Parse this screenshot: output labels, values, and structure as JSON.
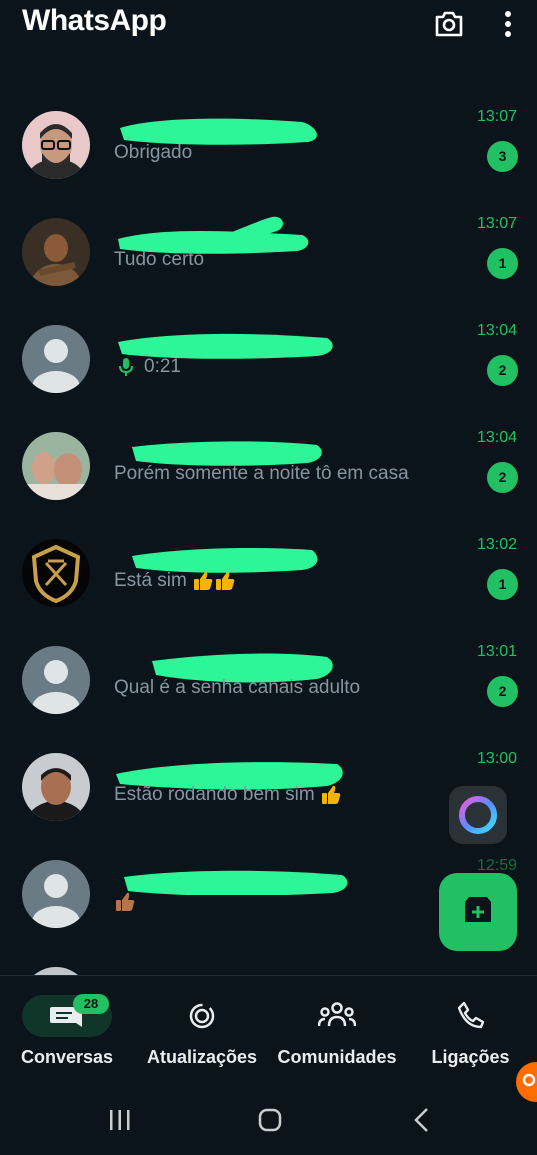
{
  "app": {
    "title": "WhatsApp"
  },
  "header_icons": [
    "camera-icon",
    "more-vertical-icon"
  ],
  "chats": [
    {
      "time": "13:07",
      "preview": "Obrigado",
      "unread": "3"
    },
    {
      "time": "13:07",
      "preview": "Tudo certo",
      "unread": "1"
    },
    {
      "time": "13:04",
      "preview": "0:21",
      "unread": "2",
      "voice": true
    },
    {
      "time": "13:04",
      "preview": "Porém somente a noite tô em casa",
      "unread": "2"
    },
    {
      "time": "13:02",
      "preview": "Está sim",
      "unread": "1"
    },
    {
      "time": "13:01",
      "preview": "Qual é a senha canais adulto",
      "unread": "2"
    },
    {
      "time": "13:00",
      "preview": "Estão rodando bem sim",
      "unread": ""
    },
    {
      "time": "12:59",
      "preview": "",
      "unread": ""
    }
  ],
  "nav": {
    "chats": {
      "label": "Conversas",
      "badge": "28"
    },
    "updates": {
      "label": "Atualizações"
    },
    "communities": {
      "label": "Comunidades"
    },
    "calls": {
      "label": "Ligações"
    }
  },
  "colors": {
    "accent": "#21c063",
    "background": "#0b141a",
    "redaction": "#2ef598"
  }
}
